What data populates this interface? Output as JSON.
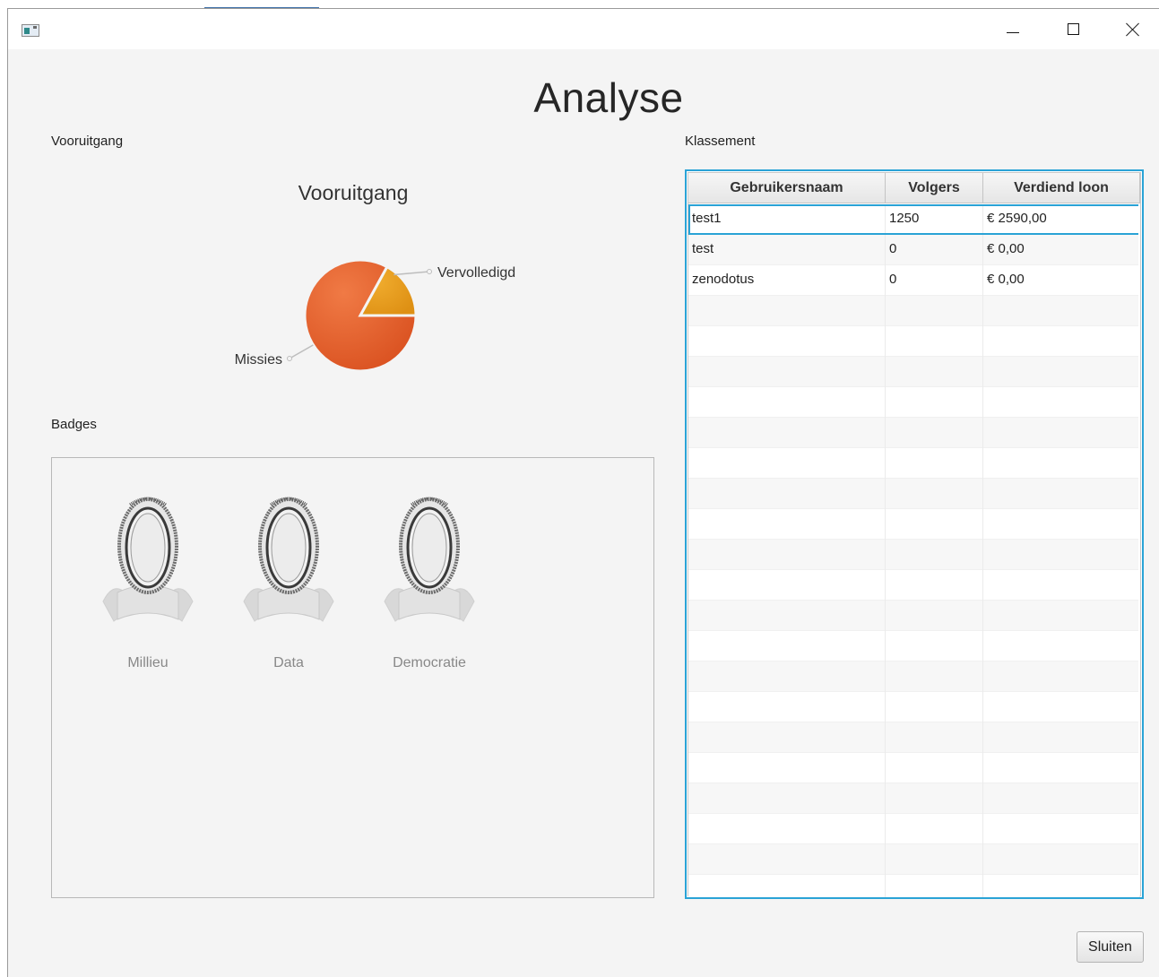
{
  "window": {
    "icon": "app-window-icon",
    "controls": [
      "minimize-icon",
      "maximize-icon",
      "close-icon"
    ]
  },
  "page": {
    "title": "Analyse"
  },
  "progress": {
    "section_label": "Vooruitgang",
    "chart_title": "Vooruitgang"
  },
  "chart_data": {
    "type": "pie",
    "title": "Vooruitgang",
    "slices": [
      {
        "label": "Missies",
        "value": 83,
        "color": "#e05a2c"
      },
      {
        "label": "Vervolledigd",
        "value": 17,
        "color": "#e8a020"
      }
    ]
  },
  "badges": {
    "section_label": "Badges",
    "items": [
      {
        "label": "Millieu",
        "icon": "badge-medal-icon"
      },
      {
        "label": "Data",
        "icon": "badge-medal-icon"
      },
      {
        "label": "Democratie",
        "icon": "badge-medal-icon"
      }
    ]
  },
  "ranking": {
    "section_label": "Klassement",
    "columns": [
      "Gebruikersnaam",
      "Volgers",
      "Verdiend loon"
    ],
    "rows": [
      [
        "test1",
        "1250",
        "€ 2590,00"
      ],
      [
        "test",
        "0",
        "€ 0,00"
      ],
      [
        "zenodotus",
        "0",
        "€ 0,00"
      ]
    ],
    "selected_row": 0
  },
  "footer": {
    "close_label": "Sluiten"
  },
  "colors": {
    "accent": "#2aa3d6",
    "background": "#f4f4f4"
  }
}
